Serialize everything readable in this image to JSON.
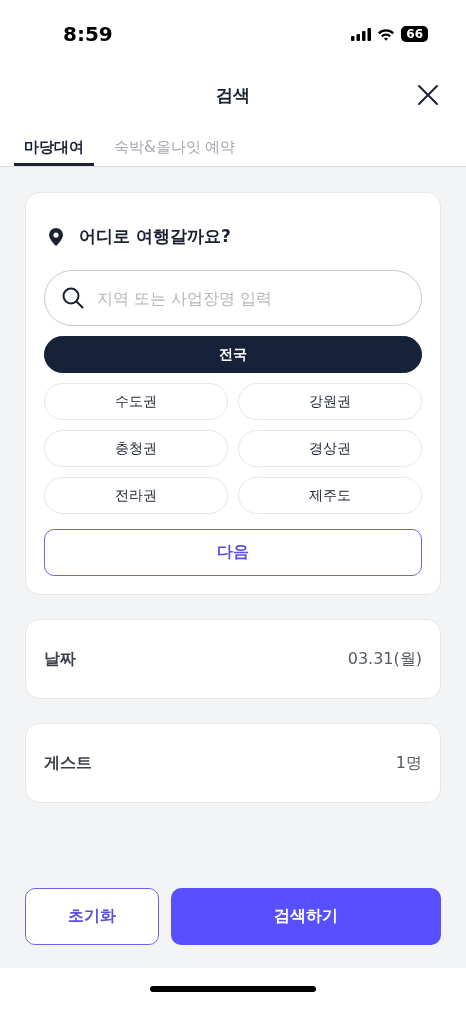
{
  "status_bar": {
    "time": "8:59",
    "battery": "66"
  },
  "header": {
    "title": "검색"
  },
  "tabs": [
    {
      "label": "마당대여",
      "selected": true
    },
    {
      "label": "숙박&올나잇 예약",
      "selected": false
    }
  ],
  "destination": {
    "heading": "어디로 여행갈까요?",
    "search": {
      "placeholder": "지역 또는 사업장명 입력"
    },
    "regions": [
      {
        "label": "전국",
        "kind": "all",
        "selected": true
      },
      {
        "label": "수도권",
        "kind": "region",
        "selected": false
      },
      {
        "label": "강원권",
        "kind": "region",
        "selected": false
      },
      {
        "label": "충청권",
        "kind": "region",
        "selected": false
      },
      {
        "label": "경상권",
        "kind": "region",
        "selected": false
      },
      {
        "label": "전라권",
        "kind": "region",
        "selected": false
      },
      {
        "label": "제주도",
        "kind": "region",
        "selected": false
      }
    ],
    "next_button": "다음"
  },
  "fields": [
    {
      "label": "날짜",
      "value": "03.31(월)"
    },
    {
      "label": "게스트",
      "value": "1명"
    }
  ],
  "footer": {
    "reset_button": "초기화",
    "search_button": "검색하기"
  }
}
